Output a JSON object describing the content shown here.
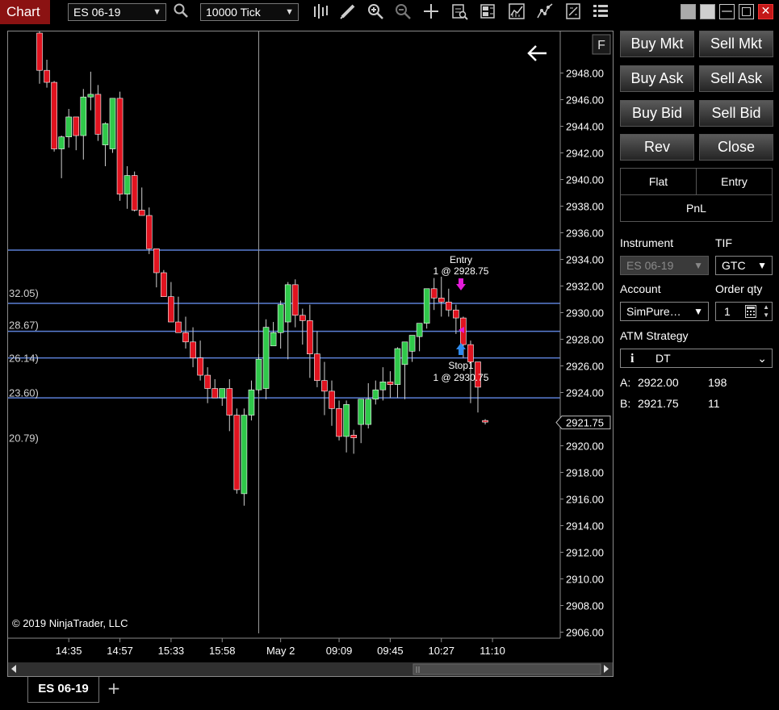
{
  "toolbar": {
    "chart_label": "Chart",
    "instrument": "ES 06-19",
    "interval": "10000 Tick",
    "icons": [
      "search-icon",
      "bar-type-icon",
      "drawing-tool-icon",
      "zoom-in-icon",
      "zoom-out-icon",
      "crosshair-icon",
      "data-box-icon",
      "properties-icon",
      "indicators-icon",
      "strategies-icon",
      "templates-icon",
      "list-icon"
    ]
  },
  "window": {
    "restore": "",
    "maximize": "",
    "minimize": "—",
    "max": "□",
    "close": "✕"
  },
  "chart": {
    "copyright": "© 2019 NinjaTrader, LLC",
    "f_button": "F",
    "price_labels": [
      "2948.00",
      "2946.00",
      "2944.00",
      "2942.00",
      "2940.00",
      "2938.00",
      "2936.00",
      "2934.00",
      "2932.00",
      "2930.00",
      "2928.00",
      "2926.00",
      "2924.00",
      "2922.00",
      "2920.00",
      "2918.00",
      "2916.00",
      "2914.00",
      "2912.00",
      "2910.00",
      "2908.00",
      "2906.00"
    ],
    "price_values": [
      2948,
      2946,
      2944,
      2942,
      2940,
      2938,
      2936,
      2934,
      2932,
      2930,
      2928,
      2926,
      2924,
      2922,
      2920,
      2918,
      2916,
      2914,
      2912,
      2910,
      2908,
      2906
    ],
    "current_price": "2921.75",
    "current_price_value": 2921.75,
    "time_labels": [
      "14:35",
      "14:57",
      "15:33",
      "15:58",
      "May 2",
      "09:09",
      "09:45",
      "10:27",
      "11:10"
    ],
    "time_label_bar_index": [
      4,
      11,
      18,
      25,
      33,
      41,
      48,
      55,
      62
    ],
    "left_labels": [
      "32.05)",
      "28.67)",
      "26.14)",
      "23.60)",
      "20.79)"
    ],
    "left_label_prices": [
      2931.5,
      2929.1,
      2926.6,
      2924.0,
      2920.6
    ],
    "hlines": [
      2934.7,
      2930.7,
      2928.6,
      2926.6,
      2923.6
    ],
    "vline_bar_index": 30,
    "entry_marker": {
      "title": "Entry",
      "detail": "1 @ 2928.75"
    },
    "stop_marker": {
      "title": "Stop1",
      "detail": "1 @ 2930.75"
    },
    "colors": {
      "up": "#2fc84a",
      "down": "#e0131f",
      "hline": "#5b7fd6",
      "entry_arrow": "#e41bd9",
      "stop_arrow": "#2f8cf0",
      "wick": "#cfcfcf"
    },
    "bars": [
      [
        2951,
        2952,
        2947.2,
        2948.2
      ],
      [
        2948.2,
        2949,
        2946.9,
        2947.3
      ],
      [
        2947.3,
        2947.4,
        2942.1,
        2942.3
      ],
      [
        2942.3,
        2943.3,
        2940.1,
        2943.2
      ],
      [
        2943.2,
        2945.3,
        2942.4,
        2944.7
      ],
      [
        2944.7,
        2944.7,
        2942.2,
        2943.3
      ],
      [
        2943.3,
        2946.8,
        2941.5,
        2946.2
      ],
      [
        2946.2,
        2948.1,
        2945.2,
        2946.4
      ],
      [
        2946.4,
        2947.1,
        2942.9,
        2943.4
      ],
      [
        2942.6,
        2944.3,
        2941,
        2944.2
      ],
      [
        2942.3,
        2946.1,
        2942,
        2946.1
      ],
      [
        2946.1,
        2946.6,
        2938.4,
        2938.9
      ],
      [
        2938.9,
        2941,
        2937.8,
        2940.3
      ],
      [
        2940.3,
        2940.6,
        2937.6,
        2937.7
      ],
      [
        2937.7,
        2939.4,
        2937.3,
        2937.3
      ],
      [
        2937.3,
        2937.9,
        2934.4,
        2934.8
      ],
      [
        2934.8,
        2934.8,
        2931.9,
        2933
      ],
      [
        2933,
        2933.2,
        2932.2,
        2931.2
      ],
      [
        2931.2,
        2932.3,
        2929.3,
        2929.3
      ],
      [
        2929.3,
        2931.2,
        2928.9,
        2928.5
      ],
      [
        2928.5,
        2929.7,
        2927.3,
        2927.8
      ],
      [
        2927.8,
        2928.9,
        2925.9,
        2926.6
      ],
      [
        2926.6,
        2927.9,
        2924.9,
        2925.3
      ],
      [
        2925.3,
        2925.9,
        2923.2,
        2924.3
      ],
      [
        2924.3,
        2925,
        2923.6,
        2923.6
      ],
      [
        2923.6,
        2924.1,
        2923,
        2924.3
      ],
      [
        2924.3,
        2925,
        2921.1,
        2922.3
      ],
      [
        2922.3,
        2922.8,
        2916.4,
        2916.7
      ],
      [
        2916.4,
        2922.8,
        2915.5,
        2922.3
      ],
      [
        2922.3,
        2924.9,
        2921.9,
        2924.2
      ],
      [
        2924.2,
        2926.9,
        2923.9,
        2926.5
      ],
      [
        2924.3,
        2929.5,
        2923.5,
        2928.9
      ],
      [
        2927.5,
        2929.3,
        2927.5,
        2928.5
      ],
      [
        2928.5,
        2930.9,
        2927.3,
        2930.6
      ],
      [
        2929.3,
        2932.3,
        2926.5,
        2932.1
      ],
      [
        2932.1,
        2932.5,
        2928.9,
        2929.8
      ],
      [
        2929.8,
        2930.3,
        2927.6,
        2929.4
      ],
      [
        2929.4,
        2930.6,
        2925.1,
        2926.9
      ],
      [
        2926.9,
        2928.6,
        2924.4,
        2924.9
      ],
      [
        2924.9,
        2926.3,
        2922.3,
        2924.1
      ],
      [
        2924.1,
        2924.9,
        2921.5,
        2922.8
      ],
      [
        2922.8,
        2923.4,
        2920.4,
        2920.7
      ],
      [
        2920.7,
        2923.4,
        2919.5,
        2923.1
      ],
      [
        2920.8,
        2921.2,
        2919.4,
        2920.6
      ],
      [
        2921.6,
        2923.5,
        2920.2,
        2923.5
      ],
      [
        2921.6,
        2924.7,
        2921.3,
        2923.5
      ],
      [
        2923.5,
        2924.9,
        2923.1,
        2924.2
      ],
      [
        2924.2,
        2925.9,
        2923.4,
        2924.8
      ],
      [
        2924.8,
        2925.6,
        2923.6,
        2924.6
      ],
      [
        2924.6,
        2927.4,
        2923.6,
        2927.3
      ],
      [
        2926.1,
        2927.8,
        2923.5,
        2927.8
      ],
      [
        2927.1,
        2928.2,
        2926.3,
        2928.3
      ],
      [
        2928.2,
        2929.1,
        2927.1,
        2929.2
      ],
      [
        2929.2,
        2931.2,
        2928.8,
        2931.8
      ],
      [
        2931.8,
        2932.6,
        2930.2,
        2931.1
      ],
      [
        2931.1,
        2932.7,
        2929.7,
        2930.8
      ],
      [
        2930.8,
        2931.8,
        2929.7,
        2930.2
      ],
      [
        2930.2,
        2930.6,
        2928.4,
        2929.6
      ],
      [
        2929.6,
        2929.7,
        2926.6,
        2927.6
      ],
      [
        2927.6,
        2927.9,
        2923.2,
        2926.3
      ],
      [
        2926.3,
        2925.9,
        2922.5,
        2924.4
      ],
      [
        2921.9,
        2922,
        2921.6,
        2921.8
      ]
    ]
  },
  "panel": {
    "buy_mkt": "Buy Mkt",
    "sell_mkt": "Sell Mkt",
    "buy_ask": "Buy Ask",
    "sell_ask": "Sell Ask",
    "buy_bid": "Buy Bid",
    "sell_bid": "Sell Bid",
    "rev": "Rev",
    "close": "Close",
    "flat": "Flat",
    "entry": "Entry",
    "pnl": "PnL",
    "instrument_label": "Instrument",
    "instrument_value": "ES 06-19",
    "tif_label": "TIF",
    "tif_value": "GTC",
    "account_label": "Account",
    "account_value": "SimPure…",
    "order_qty_label": "Order qty",
    "order_qty_value": "1",
    "atm_label": "ATM Strategy",
    "atm_info": "i",
    "atm_value": "DT",
    "ask_label": "A:",
    "ask_price": "2922.00",
    "ask_size": "198",
    "bid_label": "B:",
    "bid_price": "2921.75",
    "bid_size": "11"
  },
  "bottom": {
    "tab_label": "ES 06-19",
    "add_tab": "+"
  }
}
